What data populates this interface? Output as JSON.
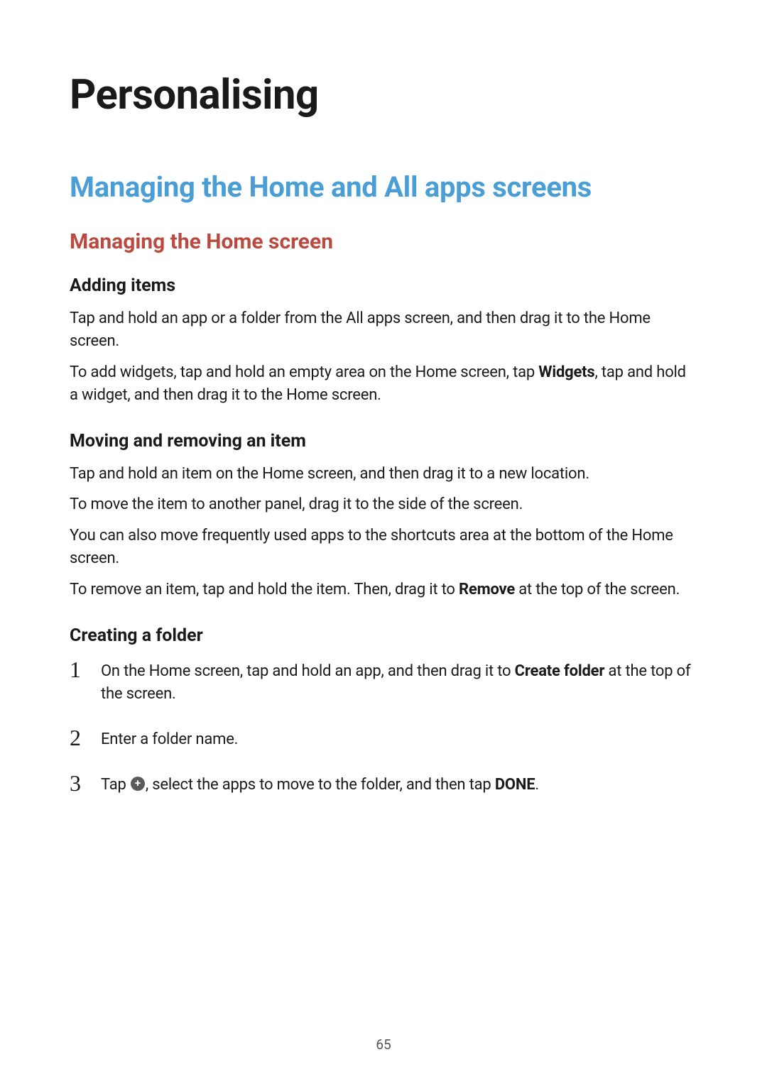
{
  "page_number": "65",
  "chapter_title": "Personalising",
  "section_title": "Managing the Home and All apps screens",
  "subsection_title": "Managing the Home screen",
  "topics": {
    "adding_items": {
      "title": "Adding items",
      "p1": "Tap and hold an app or a folder from the All apps screen, and then drag it to the Home screen.",
      "p2_a": "To add widgets, tap and hold an empty area on the Home screen, tap ",
      "p2_bold": "Widgets",
      "p2_b": ", tap and hold a widget, and then drag it to the Home screen."
    },
    "moving_removing": {
      "title": "Moving and removing an item",
      "p1": "Tap and hold an item on the Home screen, and then drag it to a new location.",
      "p2": "To move the item to another panel, drag it to the side of the screen.",
      "p3": "You can also move frequently used apps to the shortcuts area at the bottom of the Home screen.",
      "p4_a": "To remove an item, tap and hold the item. Then, drag it to ",
      "p4_bold": "Remove",
      "p4_b": " at the top of the screen."
    },
    "creating_folder": {
      "title": "Creating a folder",
      "steps": {
        "s1_num": "1",
        "s1_a": "On the Home screen, tap and hold an app, and then drag it to ",
        "s1_bold": "Create folder",
        "s1_b": " at the top of the screen.",
        "s2_num": "2",
        "s2": "Enter a folder name.",
        "s3_num": "3",
        "s3_a": "Tap ",
        "s3_b": ", select the apps to move to the folder, and then tap ",
        "s3_bold": "DONE",
        "s3_c": "."
      }
    }
  }
}
